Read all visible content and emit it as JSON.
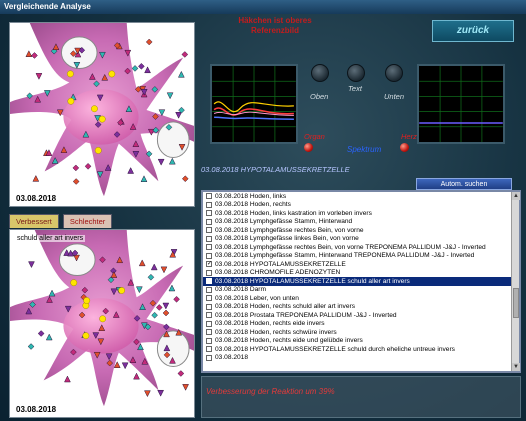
{
  "window": {
    "title": "Vergleichende Analyse"
  },
  "header": {
    "hint_line1": "Häkchen ist oberes",
    "hint_line2": "Referenzbild",
    "back_label": "zurück"
  },
  "images": {
    "top_date": "03.08.2018",
    "bottom_date": "03.08.2018",
    "bottom_note": "schuld aller art invers"
  },
  "tabs": {
    "better_label": "Verbessert",
    "worse_label": "Schlechter"
  },
  "controls": {
    "oben_label": "Oben",
    "text_label": "Text",
    "unten_label": "Unten",
    "organ_label": "Organ",
    "herz_label": "Herz",
    "spektrum_label": "Spektrum"
  },
  "selected_item": "03.08.2018 HYPOTALAMUSSEKRETZELLE",
  "search_button_label": "Autom. suchen",
  "list": {
    "items": [
      {
        "text": "03.08.2018  Hoden, links",
        "checked": false,
        "selected": false
      },
      {
        "text": "03.08.2018  Hoden, rechts",
        "checked": false,
        "selected": false
      },
      {
        "text": "03.08.2018  Hoden, links  kastration im vorleben invers",
        "checked": false,
        "selected": false
      },
      {
        "text": "03.08.2018  Lymphgefässe Stamm, Hinterwand",
        "checked": false,
        "selected": false
      },
      {
        "text": "03.08.2018  Lymphgefässe rechtes Bein, von vorne",
        "checked": false,
        "selected": false
      },
      {
        "text": "03.08.2018  Lymphgefässe linkes Bein, von vorne",
        "checked": false,
        "selected": false
      },
      {
        "text": "03.08.2018  Lymphgefässe rechtes Bein, von vorne  TREPONEMA  PALLIDUM  -J&J - Inverted",
        "checked": false,
        "selected": false
      },
      {
        "text": "03.08.2018  Lymphgefässe Stamm, Hinterwand  TREPONEMA  PALLIDUM  -J&J - Inverted",
        "checked": false,
        "selected": false
      },
      {
        "text": "03.08.2018  HYPOTALAMUSSEKRETZELLE",
        "checked": true,
        "selected": false
      },
      {
        "text": "03.08.2018  CHROMOFILE ADENOZYTEN",
        "checked": false,
        "selected": false
      },
      {
        "text": "03.08.2018  HYPOTALAMUSSEKRETZELLE  schuld aller art invers",
        "checked": false,
        "selected": true
      },
      {
        "text": "03.08.2018  Darm",
        "checked": false,
        "selected": false
      },
      {
        "text": "03.08.2018  Leber, von unten",
        "checked": false,
        "selected": false
      },
      {
        "text": "03.08.2018  Hoden, rechts  schuld aller art invers",
        "checked": false,
        "selected": false
      },
      {
        "text": "03.08.2018  Prostata  TREPONEMA  PALLIDUM  -J&J - Inverted",
        "checked": false,
        "selected": false
      },
      {
        "text": "03.08.2018  Hoden, rechts  eide invers",
        "checked": false,
        "selected": false
      },
      {
        "text": "03.08.2018  Hoden, rechts  schwüre invers",
        "checked": false,
        "selected": false
      },
      {
        "text": "03.08.2018  Hoden, rechts  eide und gelübde invers",
        "checked": false,
        "selected": false
      },
      {
        "text": "03.08.2018  HYPOTALAMUSSEKRETZELLE  schuld durch eheliche untreue invers",
        "checked": false,
        "selected": false
      },
      {
        "text": "03.08.2018",
        "checked": false,
        "selected": false
      }
    ]
  },
  "result_text": "Verbesserung der Reaktion um 39%"
}
